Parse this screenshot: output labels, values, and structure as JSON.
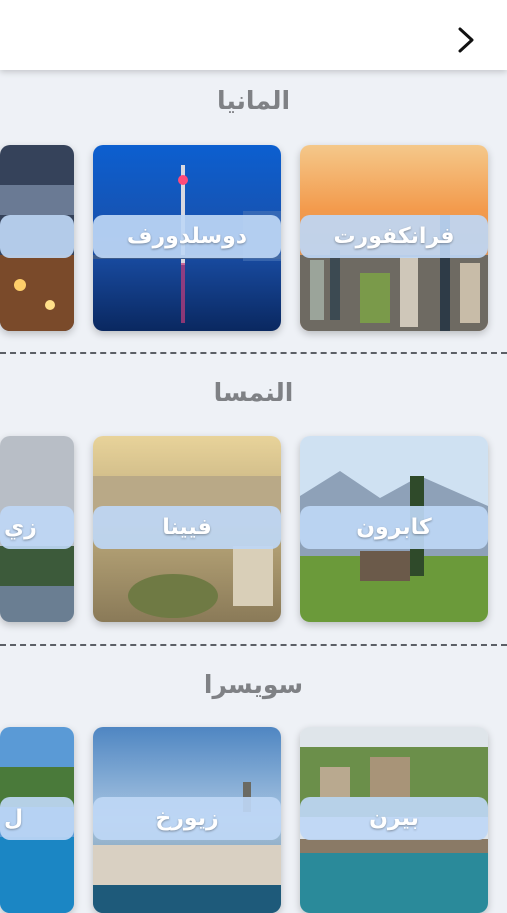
{
  "header": {
    "back_icon": "chevron-right-icon"
  },
  "sections": [
    {
      "title": "المانيا",
      "cards": [
        "فرانكفورت",
        "دوسلدورف",
        ""
      ]
    },
    {
      "title": "النمسا",
      "cards": [
        "كابرون",
        "فيينا",
        "زي"
      ]
    },
    {
      "title": "سويسرا",
      "cards": [
        "بيرن",
        "زيورخ",
        "ل"
      ]
    }
  ],
  "colors": {
    "pill": "#bed7f5",
    "title": "#7f8185",
    "background": "#eef1f6"
  }
}
